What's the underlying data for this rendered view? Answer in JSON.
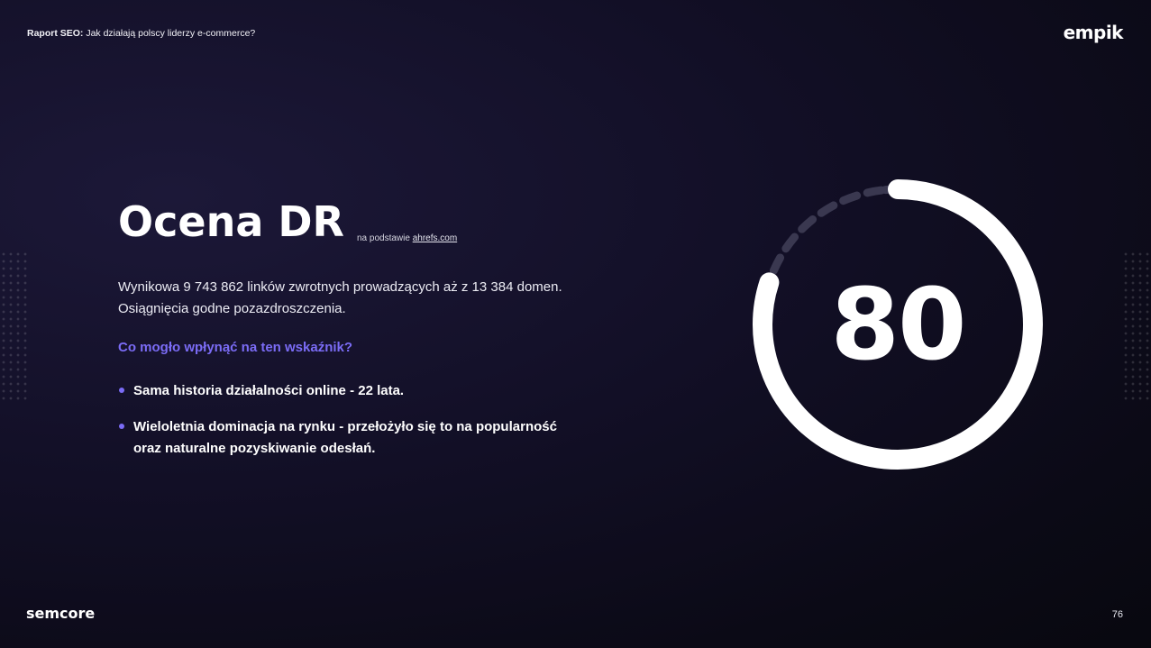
{
  "header": {
    "title_bold": "Raport SEO:",
    "title_rest": " Jak działają polscy liderzy e-commerce?",
    "brand_logo": "empik"
  },
  "main": {
    "title": "Ocena DR",
    "subtitle_prefix": "na podstawie ",
    "subtitle_link": "ahrefs.com",
    "description_line1": "Wynikowa 9 743 862 linków zwrotnych prowadzących aż z 13 384 domen.",
    "description_line2": "Osiągnięcia godne pozazdroszczenia.",
    "question": "Co mogło wpłynąć na ten wskaźnik?",
    "bullets": [
      {
        "line1": "Sama historia działalności online - 22 lata."
      },
      {
        "line1": "Wieloletnia dominacja na rynku - przełożyło się to na popularność",
        "line2": "oraz naturalne pozyskiwanie odesłań."
      }
    ]
  },
  "gauge": {
    "value": "80",
    "max": 100,
    "fill_fraction": 0.8,
    "colors": {
      "solid": "#ffffff",
      "dashed": "#3a3850",
      "accent": "#7b6cf6"
    }
  },
  "footer": {
    "brand_logo": "semcore",
    "page_number": "76"
  }
}
